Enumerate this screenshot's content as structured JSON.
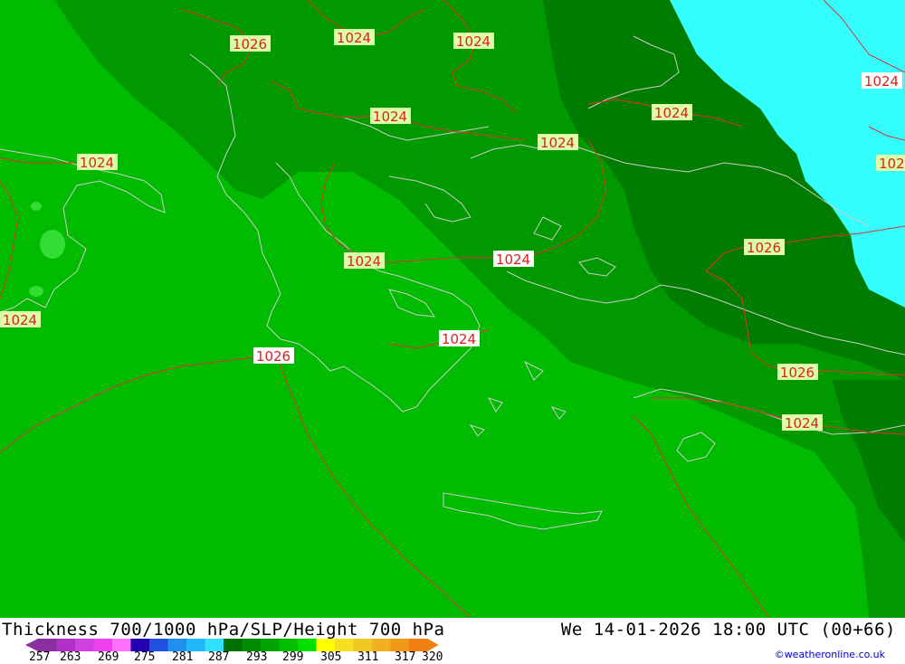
{
  "map": {
    "colors": {
      "light_green": "#00bb00",
      "mid_green": "#009a00",
      "dark_green": "#007d00",
      "cyan": "#33ffff",
      "coast": "#cccccc",
      "isobar": "#dd3333",
      "label_bg": "#ddffaa"
    },
    "isobar_labels": [
      "1026",
      "1024",
      "1024",
      "1024",
      "1024",
      "1024",
      "1024",
      "1024",
      "1024",
      "1024",
      "1026",
      "1026",
      "1024",
      "1026",
      "1024",
      "1024",
      "102"
    ]
  },
  "footer": {
    "title": "Thickness 700/1000 hPa/SLP/Height 700 hPa",
    "datetime": "We 14-01-2026 18:00 UTC (00+66)",
    "credit": "©weatheronline.co.uk",
    "scale_ticks": [
      "257",
      "263",
      "269",
      "275",
      "281",
      "287",
      "293",
      "299",
      "305",
      "311",
      "317",
      "320"
    ],
    "scale_colors": [
      "#8a2f9e",
      "#b030c8",
      "#d040e0",
      "#ee40ee",
      "#ff70ff",
      "#2000b0",
      "#2050e0",
      "#2090f0",
      "#20b8f8",
      "#30e0ff",
      "#007000",
      "#008a00",
      "#00a400",
      "#00c000",
      "#00e000",
      "#ffff00",
      "#f8e020",
      "#f0c820",
      "#f0b020",
      "#f09818",
      "#f08010"
    ]
  }
}
